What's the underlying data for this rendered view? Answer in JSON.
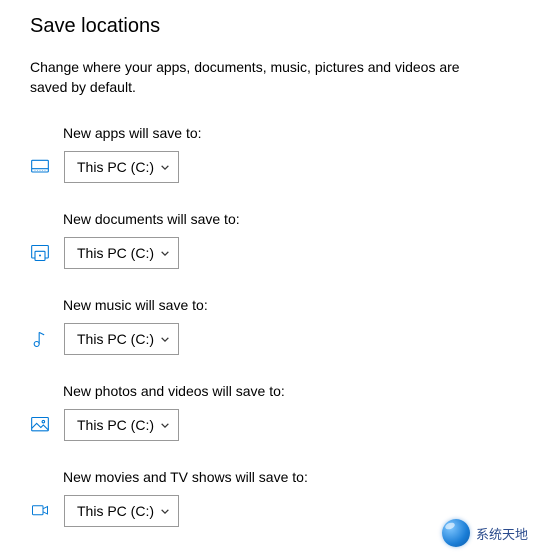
{
  "title": "Save locations",
  "description": "Change where your apps, documents, music, pictures and videos are saved by default.",
  "settings": [
    {
      "label": "New apps will save to:",
      "value": "This PC (C:)"
    },
    {
      "label": "New documents will save to:",
      "value": "This PC (C:)"
    },
    {
      "label": "New music will save to:",
      "value": "This PC (C:)"
    },
    {
      "label": "New photos and videos will save to:",
      "value": "This PC (C:)"
    },
    {
      "label": "New movies and TV shows will save to:",
      "value": "This PC (C:)"
    }
  ],
  "watermark": "系统天地"
}
